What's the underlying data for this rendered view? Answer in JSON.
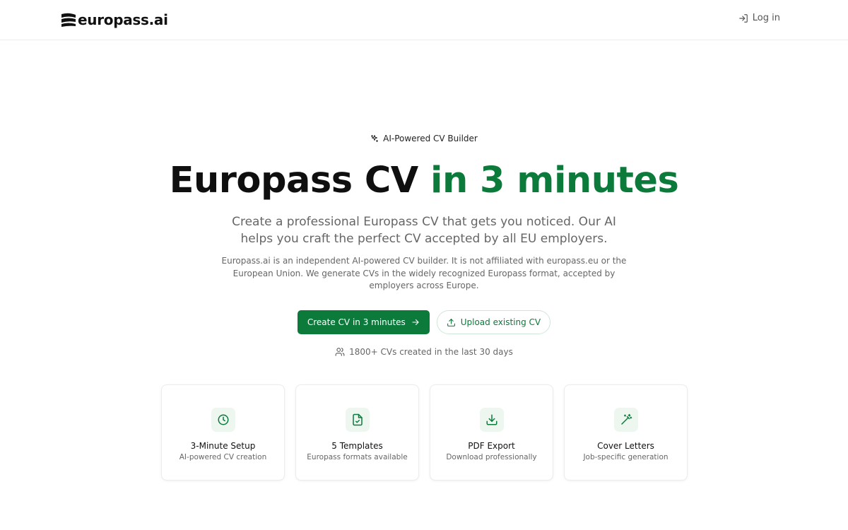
{
  "header": {
    "logo_text": "europass.ai",
    "login_label": "Log in"
  },
  "hero": {
    "badge": "AI-Powered CV Builder",
    "title_main": "Europass CV ",
    "title_accent": "in 3 minutes",
    "subtitle": "Create a professional Europass CV that gets you noticed. Our AI helps you craft the perfect CV accepted by all EU employers.",
    "disclaimer": "Europass.ai is an independent AI-powered CV builder. It is not affiliated with europass.eu or the European Union. We generate CVs in the widely recognized Europass format, accepted by employers across Europe."
  },
  "buttons": {
    "primary_label": "Create CV in 3 minutes",
    "secondary_label": "Upload existing CV"
  },
  "stats": {
    "text": "1800+ CVs created in the last 30 days"
  },
  "features": [
    {
      "icon": "clock-icon",
      "title": "3-Minute Setup",
      "desc": "AI-powered CV creation"
    },
    {
      "icon": "file-check-icon",
      "title": "5 Templates",
      "desc": "Europass formats available"
    },
    {
      "icon": "download-icon",
      "title": "PDF Export",
      "desc": "Download professionally"
    },
    {
      "icon": "magic-wand-icon",
      "title": "Cover Letters",
      "desc": "Job-specific generation"
    }
  ],
  "colors": {
    "accent": "#0b7a3b",
    "accent_light": "#edf7f0"
  }
}
